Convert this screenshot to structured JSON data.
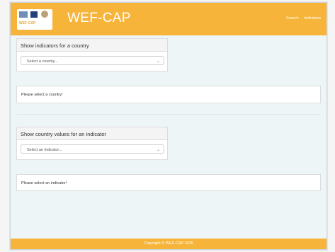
{
  "header": {
    "title": "WEF-CAP",
    "logo_text": "WEF-CAP",
    "nav": [
      "Search",
      "Indicators"
    ]
  },
  "country_panel": {
    "title": "Show indicators for a country",
    "select_placeholder": "Select a country...",
    "message": "Please select a country!"
  },
  "indicator_panel": {
    "title": "Show country values for an indicator",
    "select_placeholder": "Select an indicator...",
    "message": "Please select an indicator!"
  },
  "footer": {
    "copyright": "Copyright © WEF-CAP 2025"
  },
  "colors": {
    "brand": "#f7b43a",
    "background": "#eef5f7"
  },
  "icons": {
    "select_chevron": "chevron-down-icon"
  }
}
